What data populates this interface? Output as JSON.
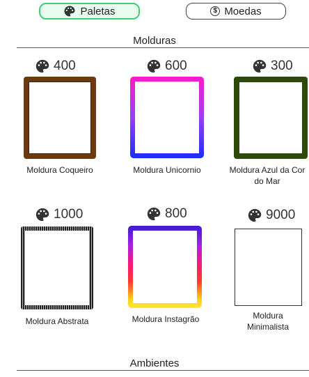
{
  "tabs": [
    {
      "label": "Paletas",
      "icon": "palette-icon",
      "active": true
    },
    {
      "label": "Moedas",
      "icon": "coin-icon",
      "active": false
    }
  ],
  "coin_symbol": "$",
  "sections": {
    "molduras": "Molduras",
    "ambientes": "Ambientes"
  },
  "items": [
    {
      "price": "400",
      "label": "Moldura Coqueiro",
      "color": "#6b3a0f"
    },
    {
      "price": "600",
      "label": "Moldura Unicornio",
      "color": "#ff1ac6"
    },
    {
      "price": "300",
      "label": "Moldura Azul da Cor do Mar",
      "color": "#2d4a0a"
    },
    {
      "price": "1000",
      "label": "Moldura Abstrata",
      "color": "#222222"
    },
    {
      "price": "800",
      "label": "Moldura Instagrão",
      "color": "#3a1bd6"
    },
    {
      "price": "9000",
      "label": "Moldura Minimalista",
      "color": "#333333"
    }
  ],
  "colors": {
    "active_tab_border": "#3fcf7a",
    "active_tab_bg": "#eafbf0",
    "icon": "#333333"
  }
}
